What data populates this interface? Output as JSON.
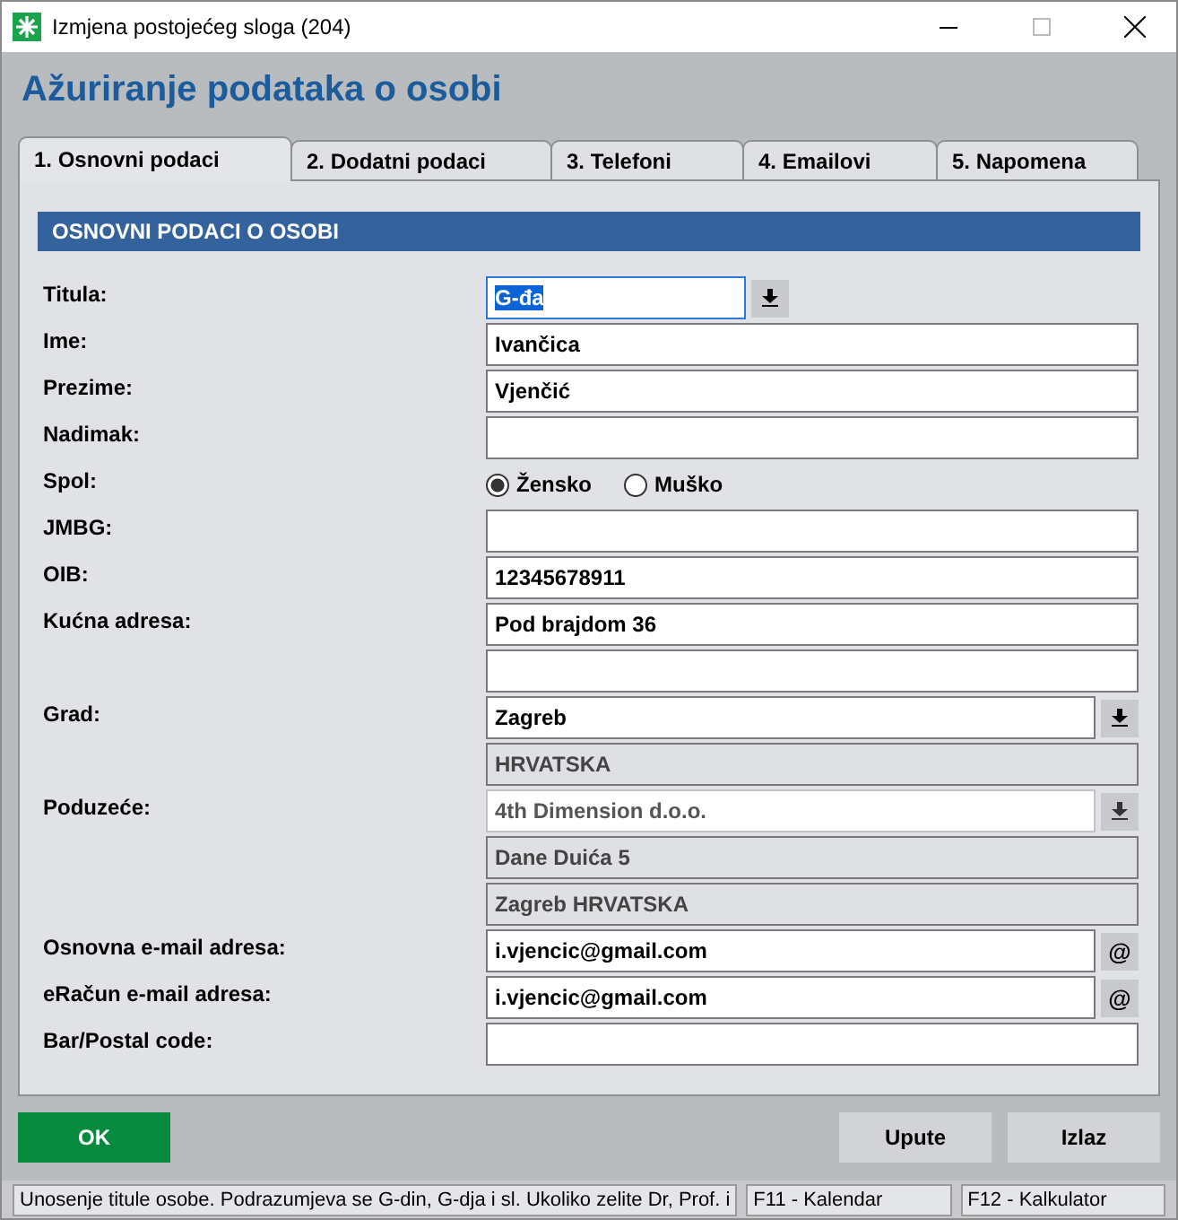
{
  "window": {
    "title": "Izmjena postojećeg sloga (204)"
  },
  "heading": "Ažuriranje podataka o osobi",
  "tabs": [
    {
      "label": "1. Osnovni podaci",
      "selected": true
    },
    {
      "label": "2. Dodatni podaci",
      "selected": false
    },
    {
      "label": "3. Telefoni",
      "selected": false
    },
    {
      "label": "4. Emailovi",
      "selected": false
    },
    {
      "label": "5. Napomena",
      "selected": false
    }
  ],
  "section_title": "OSNOVNI PODACI O OSOBI",
  "rows": [
    {
      "kind": "combo",
      "label": "Titula:",
      "value": "G-đa",
      "text_selected": true,
      "disabled": false
    },
    {
      "kind": "text",
      "label": "Ime:",
      "value": "Ivančica",
      "disabled": false
    },
    {
      "kind": "text",
      "label": "Prezime:",
      "value": "Vjenčić",
      "disabled": false
    },
    {
      "kind": "text",
      "label": "Nadimak:",
      "disabled": false
    },
    {
      "kind": "radio",
      "label": "Spol:",
      "options": [
        {
          "label": "Žensko",
          "selected": true
        },
        {
          "label": "Muško",
          "selected": false
        }
      ]
    },
    {
      "kind": "text",
      "label": "JMBG:",
      "disabled": false
    },
    {
      "kind": "text",
      "label": "OIB:",
      "value": "12345678911",
      "disabled": false
    },
    {
      "kind": "text",
      "label": "Kućna adresa:",
      "value": "Pod brajdom 36",
      "second_line": true,
      "disabled": false
    },
    {
      "kind": "combo",
      "label": "Grad:",
      "value": "Zagreb",
      "details": [
        "HRVATSKA"
      ],
      "disabled": false
    },
    {
      "kind": "combo",
      "label": "Poduzeće:",
      "value": "4th Dimension d.o.o.",
      "details": [
        "Dane Duića 5",
        "Zagreb HRVATSKA"
      ],
      "disabled": true
    },
    {
      "kind": "email",
      "label": "Osnovna e-mail adresa:",
      "value": "i.vjencic@gmail.com",
      "button_text": "@",
      "disabled": false
    },
    {
      "kind": "email",
      "label": "eRačun e-mail adresa:",
      "value": "i.vjencic@gmail.com",
      "button_text": "@",
      "disabled": false
    },
    {
      "kind": "text",
      "label": "Bar/Postal code:",
      "disabled": false
    }
  ],
  "buttons": {
    "ok": "OK",
    "help": "Upute",
    "exit": "Izlaz"
  },
  "status_bar": [
    "Unosenje titule osobe. Podrazumjeva se G-din, G-dja i sl. Ukoliko zelite Dr, Prof. i",
    "F11 - Kalendar",
    "F12 - Kalkulator"
  ]
}
